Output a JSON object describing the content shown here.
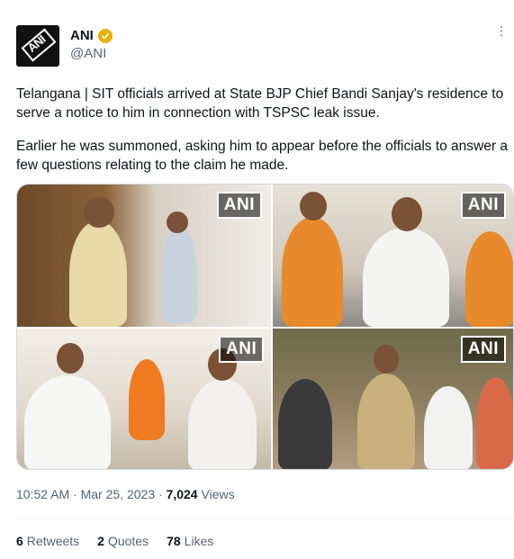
{
  "author": {
    "display_name": "ANI",
    "handle": "@ANI",
    "avatar_text": "ANI",
    "verified_color": "#e8b100"
  },
  "more_icon": "more-horizontal-icon",
  "tweet": {
    "paragraph_1": "Telangana | SIT officials arrived at State BJP Chief Bandi Sanjay's residence to serve a notice to him in connection with TSPSC leak issue.",
    "paragraph_2": "Earlier he was summoned, asking him to appear before the officials to answer a few questions relating to the claim he made."
  },
  "media": {
    "watermark": "ANI",
    "photos": [
      "photo-1",
      "photo-2",
      "photo-3",
      "photo-4"
    ]
  },
  "meta": {
    "time": "10:52 AM",
    "separator_1": "·",
    "date": "Mar 25, 2023",
    "separator_2": "·",
    "views_count": "7,024",
    "views_label": "Views"
  },
  "stats": {
    "retweets_count": "6",
    "retweets_label": "Retweets",
    "quotes_count": "2",
    "quotes_label": "Quotes",
    "likes_count": "78",
    "likes_label": "Likes"
  },
  "colors": {
    "text": "#0f1419",
    "secondary": "#536471",
    "border": "#cfd9de"
  }
}
